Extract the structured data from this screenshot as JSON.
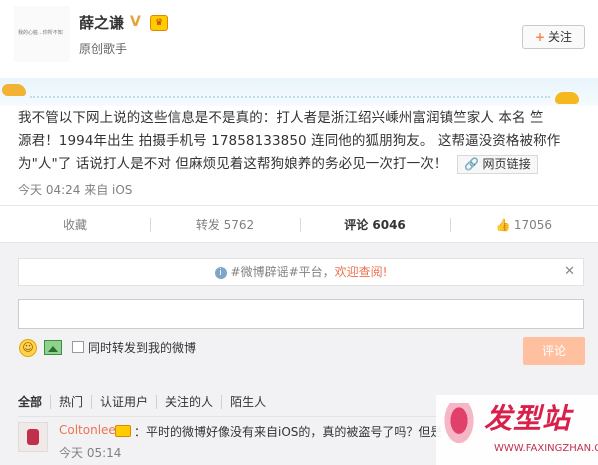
{
  "header": {
    "user_name": "薛之谦",
    "user_desc": "原创歌手",
    "verify_icon": "V",
    "avatar_caption": "我的心脏...你所不知",
    "follow_label": "关注",
    "follow_plus": "+"
  },
  "post": {
    "lines": [
      "我不管以下网上说的这些信息是不是真的：打人者是浙江绍兴嵊州富润镇竺家人 本名 竺",
      "源君！1994年出生 拍摄手机号 17858133850 连同他的狐朋狗友。 这帮逼没资格被称作",
      "为\"人\"了 话说打人是不对 但麻烦见着这帮狗娘养的务必见一次打一次！"
    ],
    "web_link_label": "网页链接",
    "meta": "今天 04:24 来自 iOS"
  },
  "actions": {
    "favorite": "收藏",
    "forward": "转发 5762",
    "comment": "评论 6046",
    "like": "17056"
  },
  "comment_box": {
    "notice_prefix": "#微博辟谣#平台，",
    "notice_link": "欢迎查阅!",
    "notice_close": "✕",
    "forward_label": "同时转发到我的微博",
    "submit_label": "评论"
  },
  "filters": [
    "全部",
    "热门",
    "认证用户",
    "关注的人",
    "陌生人"
  ],
  "comments": [
    {
      "user": "Coltonlee",
      "text": "：平时的微博好像没有来自iOS的，真的被盗号了吗？但是",
      "time": "今天 05:14"
    }
  ],
  "watermark": {
    "title": "发型站",
    "url": "WWW.FAXINGZHAN.COM"
  },
  "colors": {
    "accent": "#eb7350",
    "submit_disabled": "#ffc09f",
    "watermark": "#d8204a"
  }
}
